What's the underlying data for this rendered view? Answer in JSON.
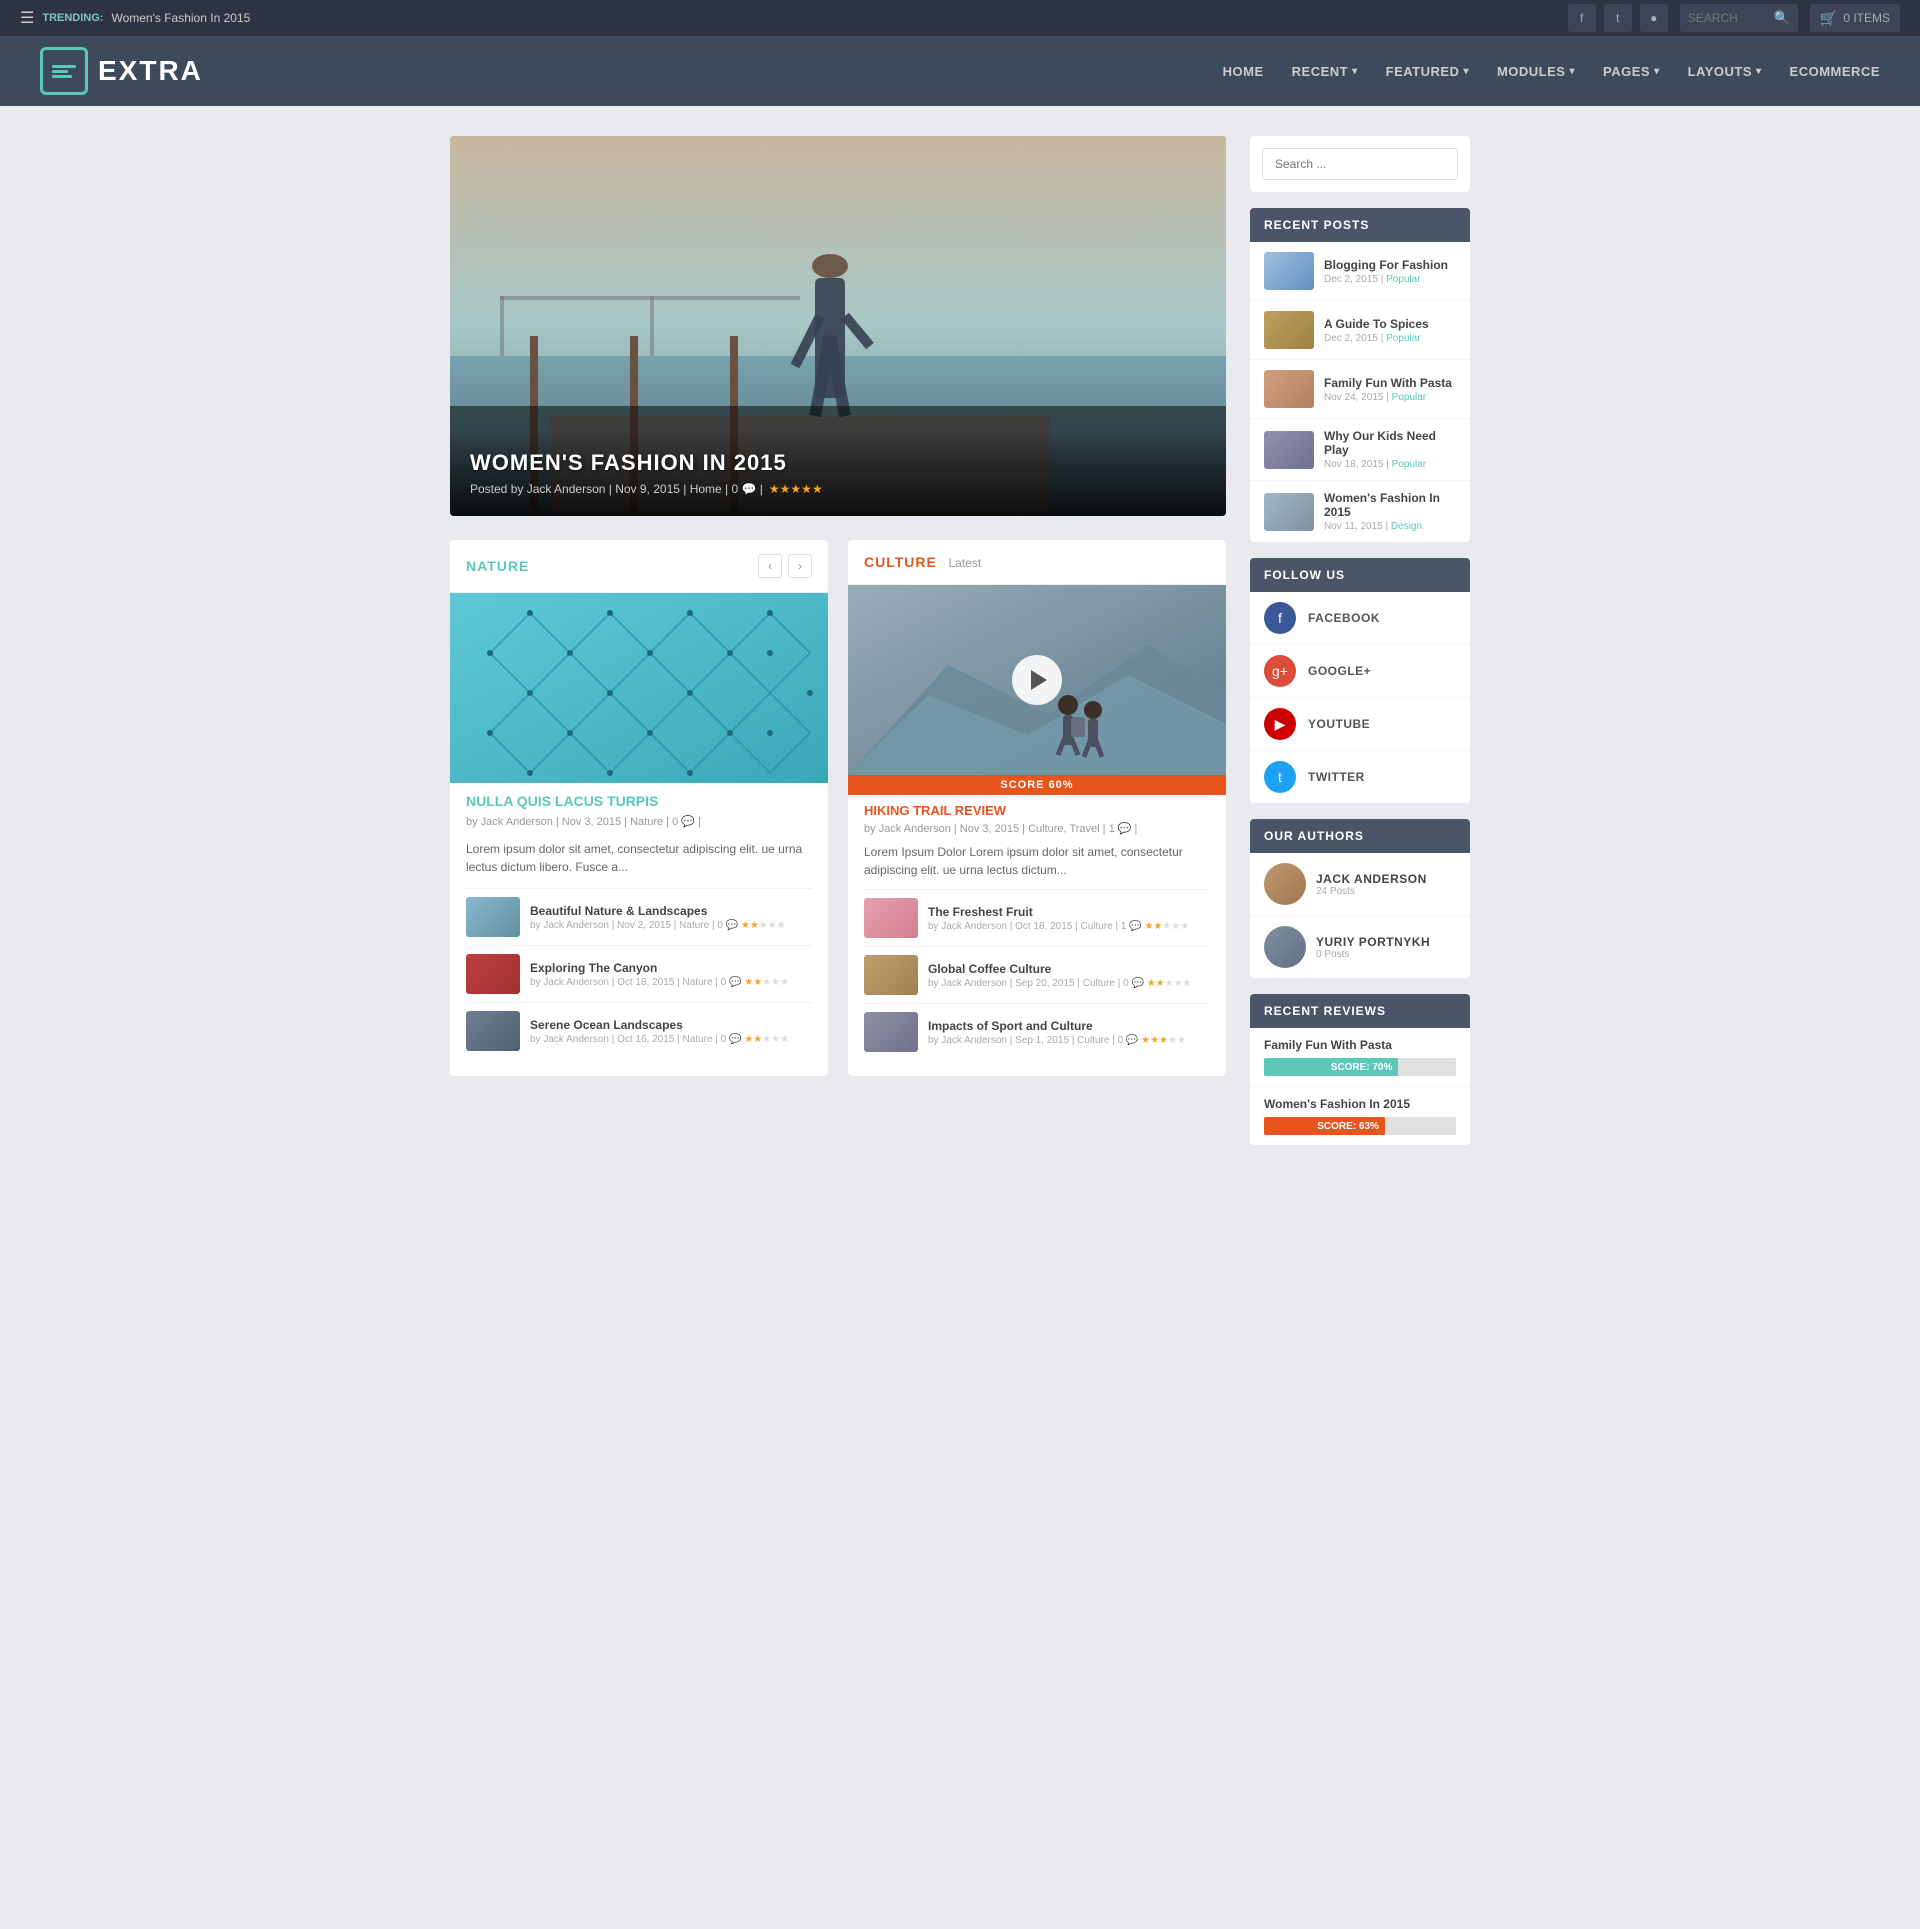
{
  "topbar": {
    "trending_label": "TRENDING:",
    "trending_text": "Women's Fashion In 2015",
    "search_placeholder": "SEARCH",
    "cart_label": "0 ITEMS"
  },
  "nav": {
    "logo_text": "EXTRA",
    "links": [
      {
        "label": "HOME",
        "has_arrow": false
      },
      {
        "label": "RECENT",
        "has_arrow": true
      },
      {
        "label": "FEATURED",
        "has_arrow": true
      },
      {
        "label": "MODULES",
        "has_arrow": true
      },
      {
        "label": "PAGES",
        "has_arrow": true
      },
      {
        "label": "LAYOUTS",
        "has_arrow": true
      },
      {
        "label": "ECOMMERCE",
        "has_arrow": false
      }
    ]
  },
  "hero": {
    "title": "WOMEN'S FASHION IN 2015",
    "meta": "Posted by Jack Anderson | Nov 9, 2015 | Home | 0 💬 |",
    "stars": "★★★★★"
  },
  "nature_section": {
    "title": "NATURE",
    "featured_title": "NULLA QUIS LACUS TURPIS",
    "featured_meta": "by Jack Anderson | Nov 3, 2015 | Nature | 0 💬 |",
    "featured_desc": "Lorem ipsum dolor sit amet, consectetur adipiscing elit. ue urna lectus dictum libero. Fusce a...",
    "list": [
      {
        "title": "Beautiful Nature & Landscapes",
        "meta": "by Jack Anderson | Nov 2, 2015 | Nature | 0 💬",
        "thumb_class": "thumb-nature1"
      },
      {
        "title": "Exploring The Canyon",
        "meta": "by Jack Anderson | Oct 18, 2015 | Nature | 0 💬",
        "thumb_class": "thumb-nature2"
      },
      {
        "title": "Serene Ocean Landscapes",
        "meta": "by Jack Anderson | Oct 16, 2015 | Nature | 0 💬",
        "thumb_class": "thumb-nature3"
      }
    ]
  },
  "culture_section": {
    "title": "CULTURE",
    "subtitle": "Latest",
    "score": "SCORE 60%",
    "featured_title": "HIKING TRAIL REVIEW",
    "featured_meta": "by Jack Anderson | Nov 3, 2015 | Culture, Travel | 1 💬 |",
    "featured_desc": "Lorem Ipsum Dolor Lorem ipsum dolor sit amet, consectetur adipiscing elit. ue urna lectus dictum...",
    "list": [
      {
        "title": "The Freshest Fruit",
        "meta": "by Jack Anderson | Oct 18, 2015 | Culture | 1 💬",
        "thumb_class": "thumb-culture1"
      },
      {
        "title": "Global Coffee Culture",
        "meta": "by Jack Anderson | Sep 20, 2015 | Culture | 0 💬",
        "thumb_class": "thumb-culture2"
      },
      {
        "title": "Impacts of Sport and Culture",
        "meta": "by Jack Anderson | Sep 1, 2015 | Culture | 0 💬",
        "thumb_class": "thumb-culture3"
      }
    ]
  },
  "sidebar": {
    "search_placeholder": "Search ...",
    "recent_posts_header": "RECENT POSTS",
    "recent_posts": [
      {
        "title": "Blogging For Fashion",
        "meta": "Dec 2, 2015",
        "badge": "Popular",
        "thumb_class": "thumb-blog1"
      },
      {
        "title": "A Guide To Spices",
        "meta": "Dec 2, 2015",
        "badge": "Popular",
        "thumb_class": "thumb-blog2"
      },
      {
        "title": "Family Fun With Pasta",
        "meta": "Nov 24, 2015",
        "badge": "Popular",
        "thumb_class": "thumb-blog3"
      },
      {
        "title": "Why Our Kids Need Play",
        "meta": "Nov 18, 2015",
        "badge": "Popular",
        "thumb_class": "thumb-blog4"
      },
      {
        "title": "Women's Fashion In 2015",
        "meta": "Nov 11, 2015",
        "badge": "Design",
        "thumb_class": "thumb-blog5"
      }
    ],
    "follow_header": "FOLLOW US",
    "follow_links": [
      {
        "label": "FACEBOOK",
        "icon": "f",
        "class": "fb-icon"
      },
      {
        "label": "GOOGLE+",
        "icon": "g+",
        "class": "gp-icon"
      },
      {
        "label": "YOUTUBE",
        "icon": "▶",
        "class": "yt-icon"
      },
      {
        "label": "TWITTER",
        "icon": "t",
        "class": "tw-icon"
      }
    ],
    "authors_header": "OUR AUTHORS",
    "authors": [
      {
        "name": "JACK ANDERSON",
        "posts": "24 Posts",
        "avatar_class": "avatar1"
      },
      {
        "name": "YURIY PORTNYKH",
        "posts": "0 Posts",
        "avatar_class": "avatar2"
      }
    ],
    "reviews_header": "RECENT REVIEWS",
    "reviews": [
      {
        "title": "Family Fun With Pasta",
        "score": "SCORE: 70%",
        "bar_class": "review-bar-pasta"
      },
      {
        "title": "Women's Fashion In 2015",
        "score": "SCORE: 63%",
        "bar_class": "review-bar-fashion"
      }
    ]
  }
}
